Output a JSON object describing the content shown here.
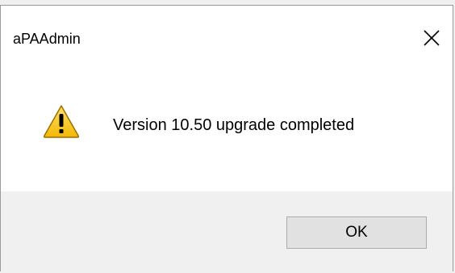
{
  "window": {
    "title": "aPAAdmin",
    "close_icon": "close-icon"
  },
  "dialog": {
    "icon": "warning-icon",
    "message": "Version 10.50 upgrade completed"
  },
  "buttons": {
    "ok_label": "OK"
  },
  "colors": {
    "dialog_background": "#ffffff",
    "footer_background": "#f0f0f0",
    "button_background": "#e1e1e1",
    "button_border": "#adadad",
    "warning_fill": "#f4c21e"
  }
}
